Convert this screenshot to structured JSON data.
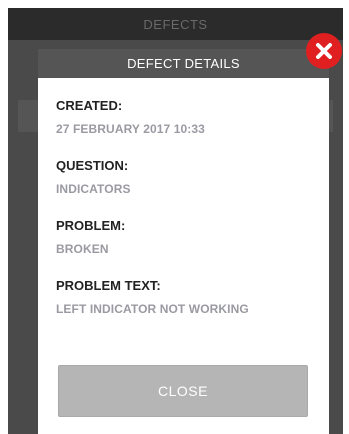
{
  "background": {
    "header_title": "DEFECTS"
  },
  "modal": {
    "title": "DEFECT DETAILS",
    "fields": [
      {
        "label": "CREATED:",
        "value": "27 FEBRUARY 2017 10:33"
      },
      {
        "label": "QUESTION:",
        "value": "INDICATORS"
      },
      {
        "label": "PROBLEM:",
        "value": "BROKEN"
      },
      {
        "label": "PROBLEM TEXT:",
        "value": "LEFT INDICATOR NOT WORKING"
      }
    ],
    "close_label": "CLOSE",
    "close_icon": "close-icon"
  },
  "colors": {
    "header": "#555555",
    "value_text": "#9a9aa2",
    "close_button": "#b5b5b5",
    "close_icon": "#e02020"
  }
}
